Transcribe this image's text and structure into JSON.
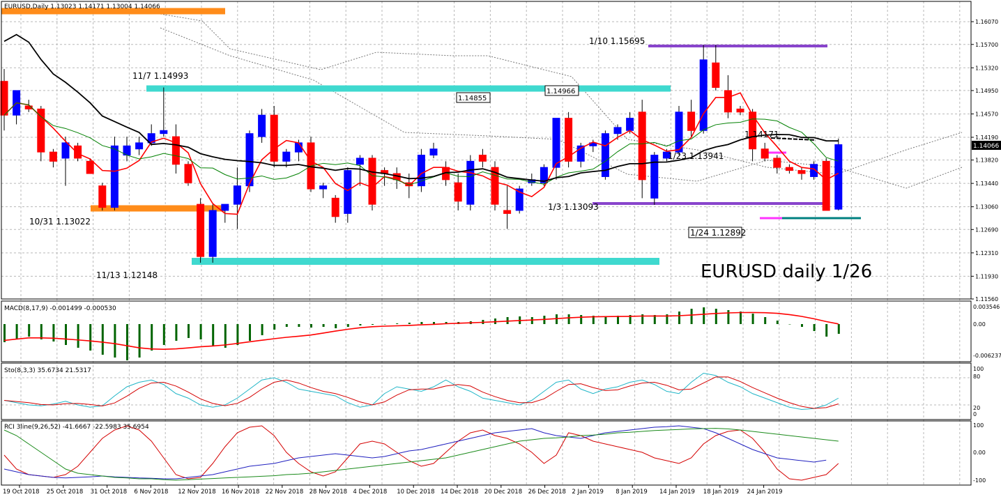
{
  "chart_data": [
    {
      "type": "candlestick",
      "panel": "price",
      "header": "EURUSD,Daily  1.13023 1.14171 1.13004 1.14066",
      "title": "EURUSD daily 1/26",
      "ylim": [
        1.1156,
        1.164
      ],
      "y_ticks": [
        "1.16070",
        "1.15700",
        "1.15320",
        "1.14950",
        "1.14570",
        "1.14190",
        "1.13820",
        "1.13440",
        "1.13060",
        "1.12690",
        "1.12310",
        "1.11930",
        "1.11560"
      ],
      "current_price": "1.14066",
      "x_labels": [
        "19 Oct 2018",
        "25 Oct 2018",
        "31 Oct 2018",
        "6 Nov 2018",
        "12 Nov 2018",
        "16 Nov 2018",
        "22 Nov 2018",
        "28 Nov 2018",
        "4 Dec 2018",
        "10 Dec 2018",
        "14 Dec 2018",
        "20 Dec 2018",
        "26 Dec 2018",
        "2 Jan 2019",
        "8 Jan 2019",
        "14 Jan 2019",
        "18 Jan 2019",
        "24 Jan 2019"
      ],
      "candles": [
        [
          1.151,
          1.153,
          1.143,
          1.1455
        ],
        [
          1.1455,
          1.1475,
          1.144,
          1.1495
        ],
        [
          1.147,
          1.148,
          1.146,
          1.1465
        ],
        [
          1.1465,
          1.147,
          1.138,
          1.1395
        ],
        [
          1.1395,
          1.14,
          1.137,
          1.138
        ],
        [
          1.1385,
          1.142,
          1.134,
          1.141
        ],
        [
          1.1405,
          1.141,
          1.138,
          1.1385
        ],
        [
          1.138,
          1.1385,
          1.136,
          1.136
        ],
        [
          1.134,
          1.1345,
          1.13,
          1.1305
        ],
        [
          1.1305,
          1.142,
          1.13,
          1.1405
        ],
        [
          1.139,
          1.142,
          1.138,
          1.1405
        ],
        [
          1.14,
          1.142,
          1.139,
          1.141
        ],
        [
          1.141,
          1.144,
          1.1405,
          1.1425
        ],
        [
          1.1425,
          1.15,
          1.142,
          1.143
        ],
        [
          1.142,
          1.144,
          1.136,
          1.1375
        ],
        [
          1.1375,
          1.138,
          1.134,
          1.1345
        ],
        [
          1.131,
          1.132,
          1.1215,
          1.1225
        ],
        [
          1.1225,
          1.131,
          1.1215,
          1.13
        ],
        [
          1.13,
          1.131,
          1.128,
          1.131
        ],
        [
          1.131,
          1.137,
          1.127,
          1.134
        ],
        [
          1.134,
          1.143,
          1.133,
          1.1425
        ],
        [
          1.142,
          1.1465,
          1.141,
          1.1455
        ],
        [
          1.1455,
          1.147,
          1.137,
          1.138
        ],
        [
          1.138,
          1.14,
          1.137,
          1.1395
        ],
        [
          1.1395,
          1.1415,
          1.138,
          1.141
        ],
        [
          1.141,
          1.142,
          1.133,
          1.1335
        ],
        [
          1.1335,
          1.1345,
          1.132,
          1.134
        ],
        [
          1.132,
          1.1325,
          1.128,
          1.129
        ],
        [
          1.1295,
          1.137,
          1.128,
          1.1365
        ],
        [
          1.1375,
          1.139,
          1.134,
          1.1385
        ],
        [
          1.1385,
          1.139,
          1.13,
          1.131
        ],
        [
          1.1365,
          1.137,
          1.134,
          1.136
        ],
        [
          1.136,
          1.137,
          1.1335,
          1.135
        ],
        [
          1.1345,
          1.136,
          1.132,
          1.134
        ],
        [
          1.134,
          1.14,
          1.133,
          1.139
        ],
        [
          1.139,
          1.141,
          1.1385,
          1.14
        ],
        [
          1.137,
          1.138,
          1.134,
          1.135
        ],
        [
          1.1345,
          1.136,
          1.13,
          1.1315
        ],
        [
          1.131,
          1.139,
          1.13,
          1.138
        ],
        [
          1.139,
          1.14,
          1.137,
          1.138
        ],
        [
          1.137,
          1.138,
          1.13,
          1.131
        ],
        [
          1.13,
          1.134,
          1.127,
          1.1295
        ],
        [
          1.13,
          1.134,
          1.1295,
          1.1335
        ],
        [
          1.1345,
          1.136,
          1.134,
          1.135
        ],
        [
          1.1345,
          1.1375,
          1.134,
          1.137
        ],
        [
          1.137,
          1.144,
          1.135,
          1.145
        ],
        [
          1.145,
          1.146,
          1.137,
          1.138
        ],
        [
          1.138,
          1.141,
          1.137,
          1.1405
        ],
        [
          1.1405,
          1.1415,
          1.1395,
          1.141
        ],
        [
          1.1355,
          1.143,
          1.135,
          1.1425
        ],
        [
          1.1425,
          1.144,
          1.1415,
          1.1435
        ],
        [
          1.143,
          1.146,
          1.1425,
          1.145
        ],
        [
          1.146,
          1.148,
          1.132,
          1.135
        ],
        [
          1.132,
          1.1395,
          1.1309,
          1.139
        ],
        [
          1.1385,
          1.14,
          1.138,
          1.1395
        ],
        [
          1.1395,
          1.147,
          1.139,
          1.146
        ],
        [
          1.146,
          1.148,
          1.142,
          1.143
        ],
        [
          1.143,
          1.1569,
          1.1425,
          1.1545
        ],
        [
          1.154,
          1.1569,
          1.1495,
          1.15
        ],
        [
          1.1495,
          1.152,
          1.145,
          1.146
        ],
        [
          1.1465,
          1.147,
          1.1455,
          1.146
        ],
        [
          1.146,
          1.1465,
          1.138,
          1.14
        ],
        [
          1.14,
          1.141,
          1.138,
          1.1385
        ],
        [
          1.1385,
          1.139,
          1.136,
          1.137
        ],
        [
          1.137,
          1.1375,
          1.136,
          1.1365
        ],
        [
          1.1365,
          1.137,
          1.135,
          1.136
        ],
        [
          1.1355,
          1.138,
          1.135,
          1.1375
        ],
        [
          1.138,
          1.1385,
          1.13,
          1.13
        ],
        [
          1.1302,
          1.1417,
          1.13,
          1.1407
        ]
      ],
      "labels": [
        "11/7 1.14993",
        "10/31 1.13022",
        "11/13 1.12148",
        "1/10 1.15695",
        "1/3 1.13093",
        "1/24 1.12892",
        "1.14171",
        "1/23 1.13941",
        "1.14855",
        "1.14966"
      ]
    },
    {
      "type": "bar+line",
      "panel": "macd",
      "header": "MACD(8,17,9) -0.001499 -0.000530",
      "y_ticks": [
        "0.003546",
        "0.00",
        "-0.006237"
      ]
    },
    {
      "type": "line",
      "panel": "stochastic",
      "header": "Sto(8,3,3) 35.6734 21.5317",
      "y_ticks": [
        "100",
        "80",
        "20",
        "0"
      ]
    },
    {
      "type": "line",
      "panel": "rci",
      "header": "RCI 3line(9,26,52) -41.6667 -22.5983 35.6954",
      "y_ticks": [
        "100",
        "0.00",
        "-100"
      ]
    }
  ]
}
